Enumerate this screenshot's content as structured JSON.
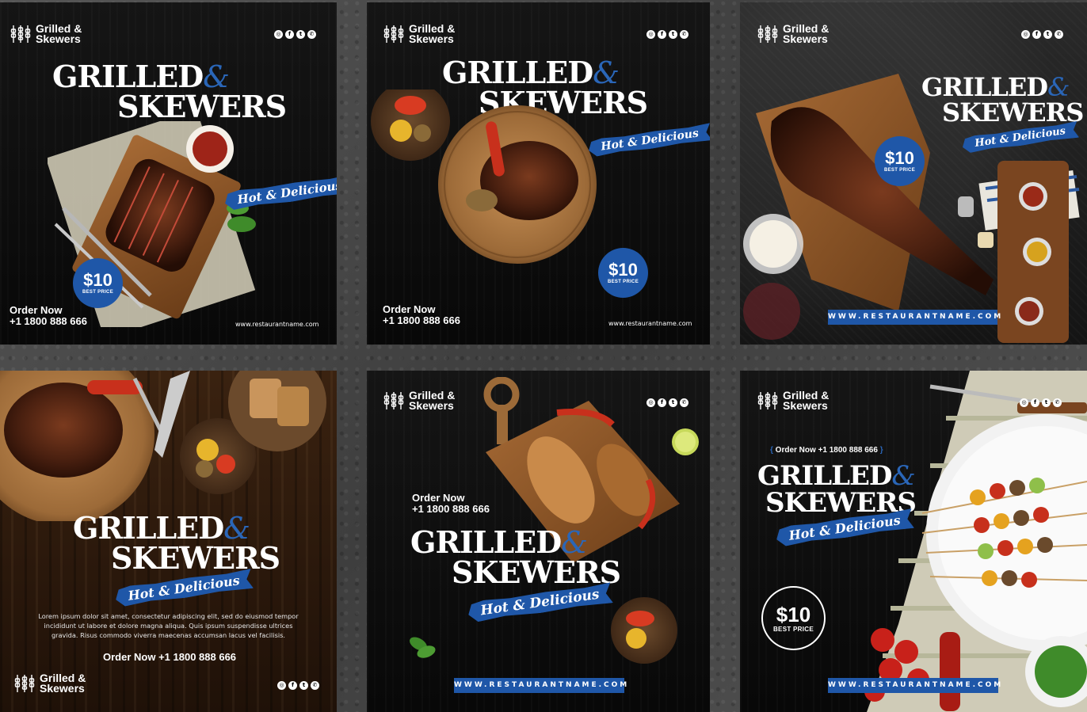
{
  "brand": {
    "logo_line1": "Grilled &",
    "logo_line2": "Skewers"
  },
  "headline": {
    "line1": "GRILLED",
    "ampersand": "&",
    "line2": "SKEWERS"
  },
  "tagline": "Hot & Delicious",
  "price": {
    "amount": "$10",
    "label": "BEST PRICE"
  },
  "order": {
    "label": "Order Now",
    "phone": "+1 1800 888 666",
    "combined": "Order Now +1 1800 888 666"
  },
  "website_lower": "www.restaurantname.com",
  "website_upper": "WWW.RESTAURANTNAME.COM",
  "lorem": "Lorem ipsum dolor sit amet, consectetur adipiscing elit, sed do eiusmod tempor incididunt ut labore et dolore magna aliqua. Quis ipsum suspendisse ultrices gravida. Risus commodo viverra maecenas accumsan lacus vel facilisis.",
  "social_icons": [
    "instagram-icon",
    "facebook-icon",
    "twitter-icon",
    "whatsapp-icon"
  ],
  "social_glyphs": [
    "◎",
    "f",
    "t",
    "✆"
  ],
  "colors": {
    "accent_blue": "#1f57a8",
    "card_black": "#0c0c0c",
    "wood_brown": "#2a170b"
  }
}
